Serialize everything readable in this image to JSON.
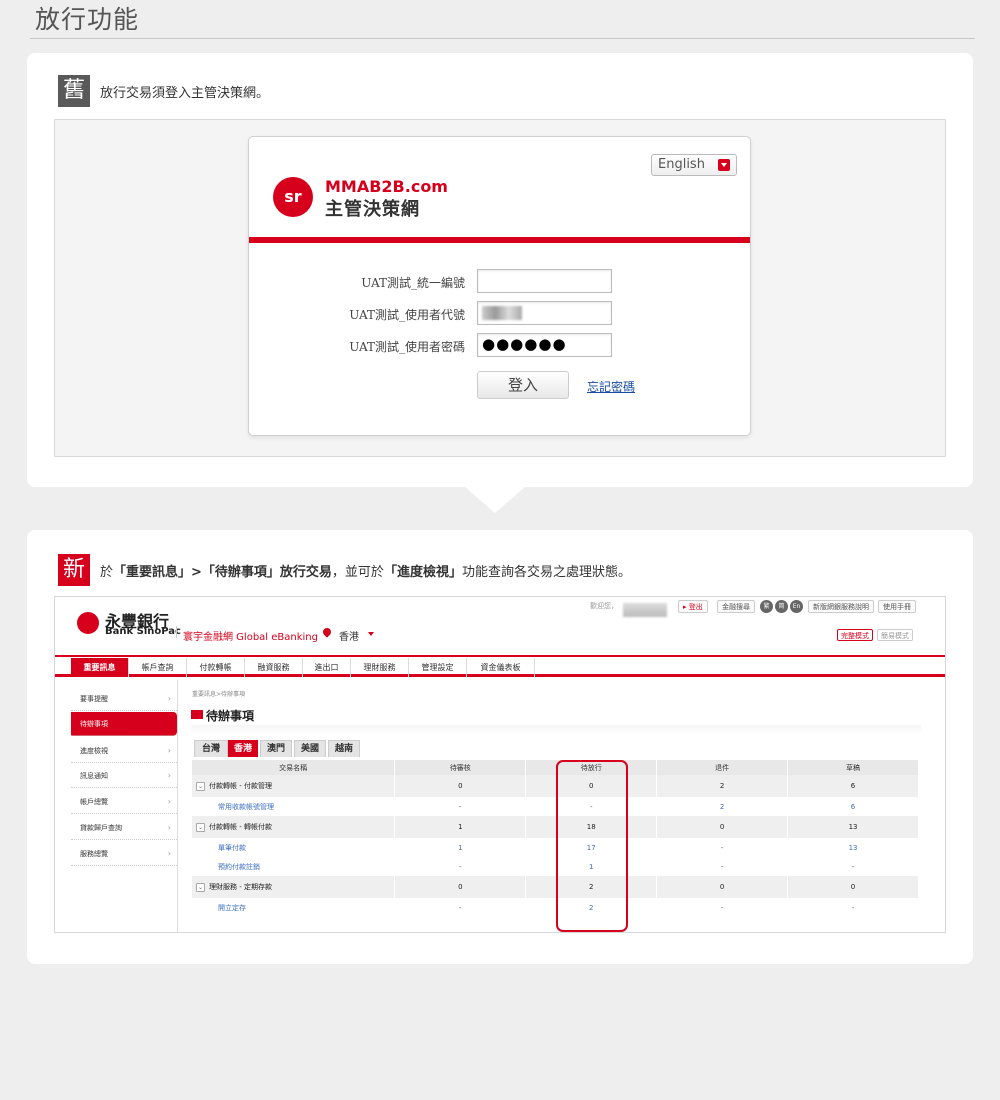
{
  "page_title": "放行功能",
  "old": {
    "tag": "舊",
    "note": "放行交易須登入主管決策網。",
    "login": {
      "brand_en": "MMAB2B.com",
      "brand_cn": "主管決策網",
      "language": "English",
      "fields": [
        {
          "label": "UAT測試_統一編號",
          "value": ""
        },
        {
          "label": "UAT測試_使用者代號",
          "value": ""
        },
        {
          "label": "UAT測試_使用者密碼",
          "value": "●●●●●●"
        }
      ],
      "login_button": "登入",
      "forgot_link": "忘記密碼"
    }
  },
  "new": {
    "tag": "新",
    "note": {
      "p1": "於",
      "b1": "「重要訊息」>「待辦事項」放行交易",
      "p2": "，並可於",
      "b2": "「進度檢視」",
      "p3": "功能查詢各交易之處理狀態。"
    },
    "bank": {
      "name_cn": "永豐銀行",
      "name_en": "Bank SinoPac",
      "product": "寰宇金融網 Global eBanking",
      "region": "香港",
      "welcome": "歡迎您，",
      "top_buttons": [
        "▸ 登出",
        "金融搜尋",
        "新版網銀服務說明",
        "使用手冊"
      ],
      "lang_buttons": [
        "繁",
        "简",
        "En"
      ],
      "modes": [
        "完整模式",
        "簡易模式"
      ],
      "nav": [
        "重要訊息",
        "帳戶查詢",
        "付款轉帳",
        "融資服務",
        "進出口",
        "理財服務",
        "管理設定",
        "資金儀表板"
      ],
      "sidebar": [
        "要事提醒",
        "待辦事項",
        "進度檢視",
        "訊息通知",
        "帳戶總覽",
        "貸款歸戶查詢",
        "服務總覽"
      ],
      "breadcrumb": "重要訊息>待辦事項",
      "section_title": "待辦事項",
      "region_tabs": [
        "台灣",
        "香港",
        "澳門",
        "美國",
        "越南"
      ],
      "columns": [
        "交易名稱",
        "待審核",
        "待放行",
        "退件",
        "草稿"
      ],
      "rows": [
        {
          "type": "grp",
          "name": "付款轉帳 - 付款管理",
          "cells": [
            "0",
            "0",
            "2",
            "6"
          ]
        },
        {
          "type": "sub",
          "name": "常用收款帳號管理",
          "cells": [
            "-",
            "-",
            "2",
            "6"
          ]
        },
        {
          "type": "grp",
          "name": "付款轉帳 - 轉帳付款",
          "cells": [
            "1",
            "18",
            "0",
            "13"
          ]
        },
        {
          "type": "sub",
          "name": "單筆付款",
          "cells": [
            "1",
            "17",
            "-",
            "13"
          ]
        },
        {
          "type": "sub",
          "name": "預約付款註銷",
          "cells": [
            "-",
            "1",
            "-",
            "-"
          ]
        },
        {
          "type": "grp",
          "name": "理財服務 - 定期存款",
          "cells": [
            "0",
            "2",
            "0",
            "0"
          ]
        },
        {
          "type": "sub",
          "name": "開立定存",
          "cells": [
            "-",
            "2",
            "-",
            "-"
          ]
        }
      ]
    }
  },
  "colors": {
    "accent": "#d7001c",
    "link": "#1a4da1"
  }
}
